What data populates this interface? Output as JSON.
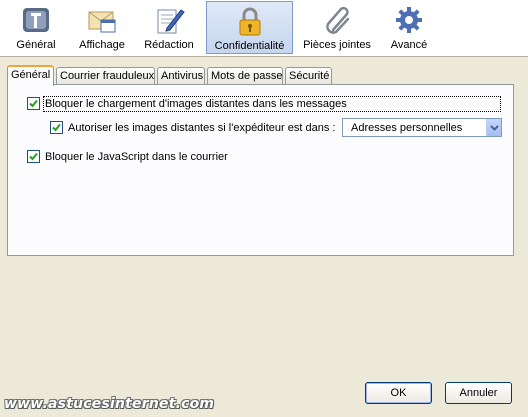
{
  "toolbar": {
    "items": [
      {
        "label": "Général",
        "icon": "general-icon"
      },
      {
        "label": "Affichage",
        "icon": "display-icon"
      },
      {
        "label": "Rédaction",
        "icon": "compose-icon"
      },
      {
        "label": "Confidentialité",
        "icon": "lock-icon",
        "selected": true
      },
      {
        "label": "Pièces jointes",
        "icon": "paperclip-icon"
      },
      {
        "label": "Avancé",
        "icon": "gear-icon"
      }
    ]
  },
  "tabs": [
    "Général",
    "Courrier frauduleux",
    "Antivirus",
    "Mots de passe",
    "Sécurité"
  ],
  "options": {
    "block_images": {
      "label": "Bloquer le chargement d'images distantes dans les messages",
      "checked": true
    },
    "allow_images": {
      "label": "Autoriser les images distantes si l'expéditeur est dans :",
      "checked": true
    },
    "allow_select": {
      "value": "Adresses personnelles"
    },
    "block_js": {
      "label": "Bloquer le JavaScript dans le courrier",
      "checked": true
    }
  },
  "buttons": {
    "ok": "OK",
    "cancel": "Annuler"
  },
  "watermark": "www.astucesinternet.com",
  "colors": {
    "background": "#ece9d8",
    "selected_tool": "#c6d6ee",
    "active_tab_accent": "#f1a33b"
  }
}
